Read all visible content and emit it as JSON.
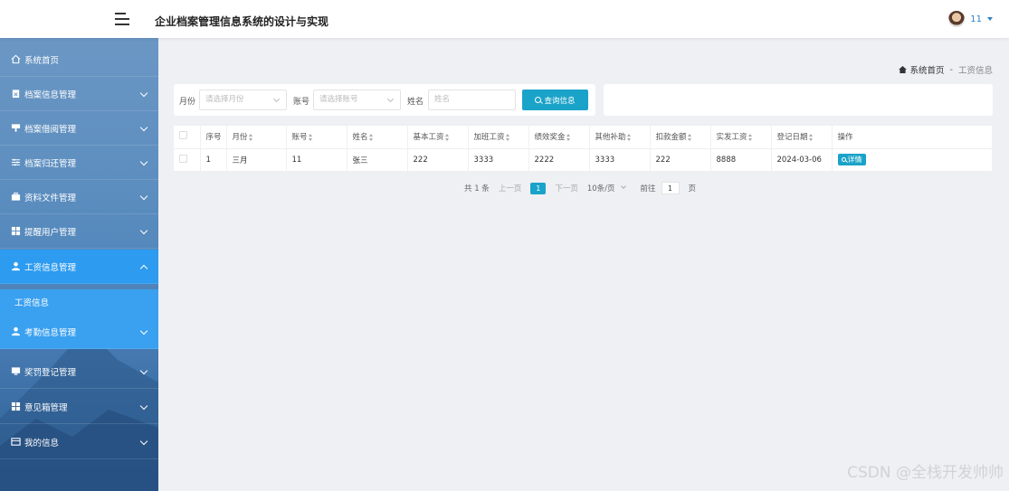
{
  "header": {
    "title": "企业档案管理信息系统的设计与实现",
    "username": "11",
    "menu_icon": "hamburger-icon",
    "avatar_icon": "avatar-icon"
  },
  "sidebar": {
    "items": [
      {
        "label": "系统首页",
        "icon": "home-icon"
      },
      {
        "label": "档案信息管理",
        "icon": "clipboard-icon"
      },
      {
        "label": "档案借阅管理",
        "icon": "stamp-icon"
      },
      {
        "label": "档案归还管理",
        "icon": "sliders-icon"
      },
      {
        "label": "资料文件管理",
        "icon": "briefcase-icon"
      },
      {
        "label": "提醒用户管理",
        "icon": "grid-icon"
      },
      {
        "label": "工资信息管理",
        "icon": "user-icon"
      },
      {
        "label": "考勤信息管理",
        "icon": "user-icon"
      },
      {
        "label": "奖罚登记管理",
        "icon": "monitor-icon"
      },
      {
        "label": "意见箱管理",
        "icon": "grid-icon"
      },
      {
        "label": "我的信息",
        "icon": "card-icon"
      }
    ],
    "submenu": {
      "label": "工资信息"
    }
  },
  "breadcrumb": {
    "home": "系统首页",
    "separator": "-",
    "current": "工资信息"
  },
  "search": {
    "month_label": "月份",
    "month_placeholder": "请选择月份",
    "account_label": "账号",
    "account_placeholder": "请选择账号",
    "name_label": "姓名",
    "name_placeholder": "姓名",
    "search_button": "查询信息"
  },
  "table": {
    "headers": [
      "序号",
      "月份",
      "账号",
      "姓名",
      "基本工资",
      "加班工资",
      "绩效奖金",
      "其他补助",
      "扣款金额",
      "实发工资",
      "登记日期",
      "操作"
    ],
    "rows": [
      {
        "index": "1",
        "month": "三月",
        "account": "11",
        "name": "张三",
        "base": "222",
        "overtime": "3333",
        "bonus": "2222",
        "subsidy": "3333",
        "deduction": "222",
        "net": "8888",
        "date": "2024-03-06",
        "action": "详情"
      }
    ]
  },
  "pagination": {
    "total": "共 1 条",
    "prev": "上一页",
    "page": "1",
    "next": "下一页",
    "page_size": "10条/页",
    "goto_label": "前往",
    "goto_value": "1",
    "goto_suffix": "页"
  },
  "watermark": "CSDN @全栈开发帅帅",
  "colors": {
    "accent": "#1aa3c8",
    "sidebar_active": "#2d9bf0",
    "sidebar_bg": "#5b8dbf",
    "page_bg": "#eef0f4"
  }
}
